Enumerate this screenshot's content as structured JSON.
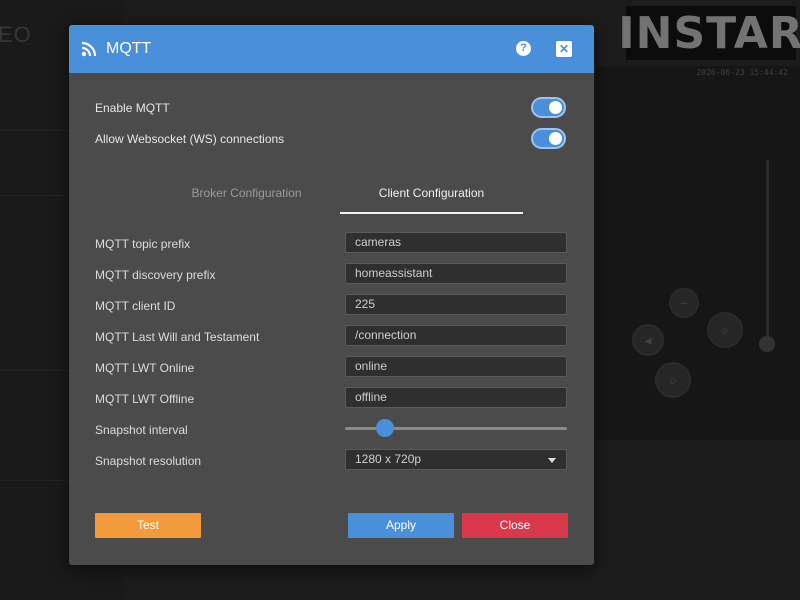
{
  "background": {
    "sidebar_title": "EO",
    "logo_text": "INSTAR",
    "video_timestamp": "2026-06-23  15:44:42"
  },
  "dialog": {
    "title": "MQTT",
    "help_icon": "?",
    "close_icon": "✕"
  },
  "toggles": [
    {
      "label": "Enable MQTT",
      "state": "on"
    },
    {
      "label": "Allow Websocket (WS) connections",
      "state": "on"
    }
  ],
  "tabs": {
    "broker": "Broker Configuration",
    "client": "Client Configuration",
    "active": "client"
  },
  "fields": {
    "topic_prefix": {
      "label": "MQTT topic prefix",
      "value": "cameras"
    },
    "discovery_prefix": {
      "label": "MQTT discovery prefix",
      "value": "homeassistant"
    },
    "client_id": {
      "label": "MQTT client ID",
      "value": "225"
    },
    "lwt_topic": {
      "label": "MQTT Last Will and Testament",
      "value": "/connection"
    },
    "lwt_online": {
      "label": "MQTT LWT Online",
      "value": "online"
    },
    "lwt_offline": {
      "label": "MQTT LWT Offline",
      "value": "offline"
    },
    "snapshot_interval": {
      "label": "Snapshot interval",
      "level": 0.18
    },
    "snapshot_resolution": {
      "label": "Snapshot resolution",
      "value": "1280 x 720p"
    }
  },
  "buttons": {
    "test": "Test",
    "apply": "Apply",
    "close": "Close"
  },
  "colors": {
    "accent": "#4a8fd9",
    "test": "#f39a3c",
    "close": "#d9394b"
  }
}
